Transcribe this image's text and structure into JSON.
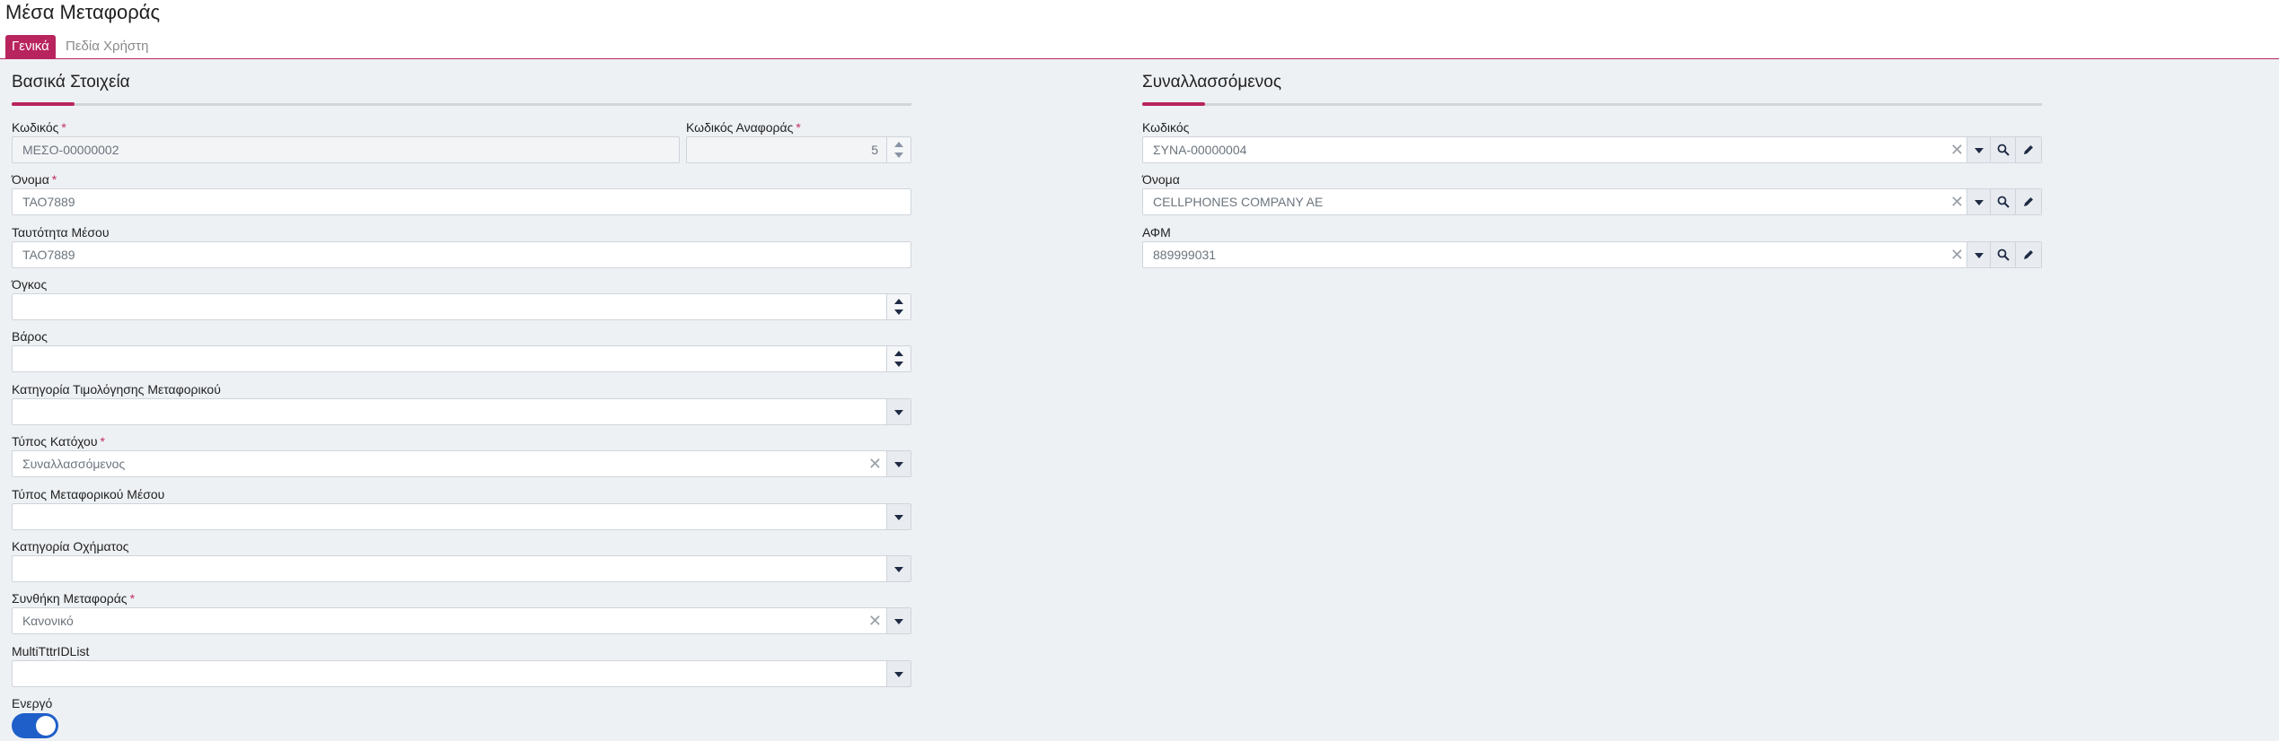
{
  "page": {
    "title": "Μέσα Μεταφοράς"
  },
  "tabs": [
    {
      "label": "Γενικά",
      "active": true
    },
    {
      "label": "Πεδία Χρήστη",
      "active": false
    }
  ],
  "basic": {
    "title": "Βασικά Στοιχεία",
    "code": {
      "label": "Κωδικός",
      "value": "ΜΕΣΟ-00000002",
      "required": "*"
    },
    "ref_code": {
      "label": "Κωδικός Αναφοράς",
      "value": "5",
      "required": "*"
    },
    "name": {
      "label": "Όνομα",
      "value": "ΤΑΟ7889",
      "required": "*"
    },
    "vehicle_id": {
      "label": "Ταυτότητα Μέσου",
      "value": "ΤΑΟ7889"
    },
    "volume": {
      "label": "Όγκος",
      "value": ""
    },
    "weight": {
      "label": "Βάρος",
      "value": ""
    },
    "pricing_category": {
      "label": "Κατηγορία Τιμολόγησης Μεταφορικού",
      "value": ""
    },
    "owner_type": {
      "label": "Τύπος Κατόχου",
      "value": "Συναλλασσόμενος",
      "required": "*"
    },
    "transport_type": {
      "label": "Τύπος Μεταφορικού Μέσου",
      "value": ""
    },
    "vehicle_category": {
      "label": "Κατηγορία Οχήματος",
      "value": ""
    },
    "transport_condition": {
      "label": "Συνθήκη Μεταφοράς",
      "value": "Κανονικό",
      "required": "*"
    },
    "multi_list": {
      "label": "MultiTttrIDList",
      "value": ""
    },
    "active": {
      "label": "Ενεργό",
      "checked": true
    }
  },
  "counterparty": {
    "title": "Συναλλασσόμενος",
    "code": {
      "label": "Κωδικός",
      "value": "ΣΥΝΑ-00000004"
    },
    "name": {
      "label": "Όνομα",
      "value": "CELLPHONES COMPANY AE"
    },
    "vat": {
      "label": "ΑΦΜ",
      "value": "889999031"
    }
  },
  "icons": {
    "clear": "close-icon",
    "dropdown": "chevron-down-icon",
    "search": "search-icon",
    "edit": "pencil-icon"
  },
  "colors": {
    "accent": "#b8245e",
    "toggle_on": "#1f5fc9",
    "background": "#eef1f4"
  }
}
